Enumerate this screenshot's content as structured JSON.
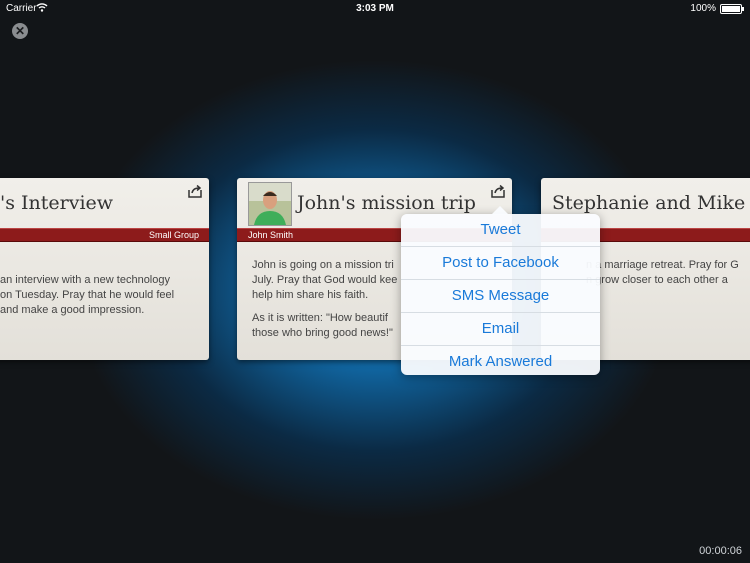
{
  "status_bar": {
    "carrier": "Carrier",
    "time": "3:03 PM",
    "battery": "100%"
  },
  "cards": [
    {
      "title": "'s Interview",
      "ribbon_label": "Small Group",
      "body": [
        "an interview with a new technology\non Tuesday. Pray that he would feel\nand make a good impression."
      ]
    },
    {
      "title": "John's mission trip",
      "ribbon_label": "John Smith",
      "body": [
        "John is going on a mission tri\nJuly. Pray that God would kee\nhelp him share his faith.",
        "As it is written: \"How beautif\nthose who bring good news!\""
      ]
    },
    {
      "title": "Stephanie and Mike",
      "body": [
        "n a marriage retreat. Pray for G\nn grow closer to each other a"
      ]
    }
  ],
  "share_menu": {
    "items": [
      "Tweet",
      "Post to Facebook",
      "SMS Message",
      "Email",
      "Mark Answered"
    ]
  },
  "timer": "00:00:06"
}
